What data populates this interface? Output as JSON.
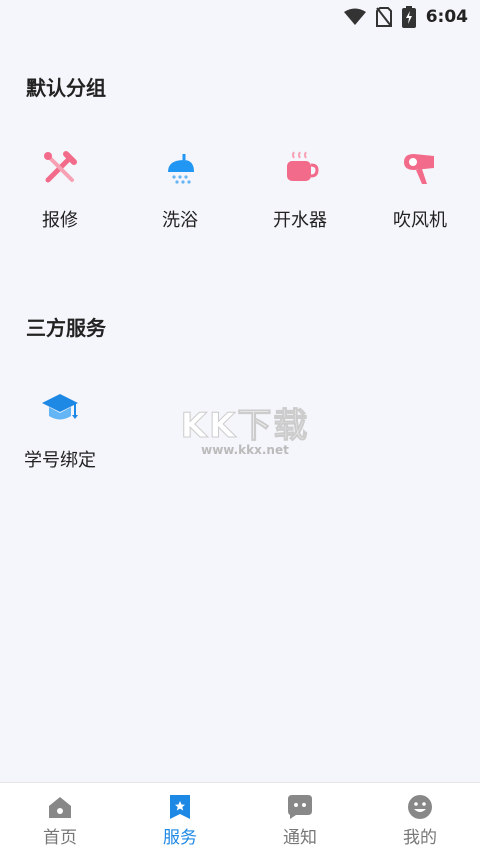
{
  "status": {
    "time": "6:04"
  },
  "groups": [
    {
      "title": "默认分组",
      "items": [
        {
          "label": "报修",
          "icon": "repair-tools-icon"
        },
        {
          "label": "洗浴",
          "icon": "shower-icon"
        },
        {
          "label": "开水器",
          "icon": "water-boiler-icon"
        },
        {
          "label": "吹风机",
          "icon": "hair-dryer-icon"
        }
      ]
    },
    {
      "title": "三方服务",
      "items": [
        {
          "label": "学号绑定",
          "icon": "graduation-cap-icon"
        }
      ]
    }
  ],
  "watermark": {
    "brand": "KK下载",
    "url": "www.kkx.net"
  },
  "nav": {
    "items": [
      {
        "label": "首页",
        "icon": "home-icon"
      },
      {
        "label": "服务",
        "icon": "service-bookmark-icon"
      },
      {
        "label": "通知",
        "icon": "chat-bubble-icon"
      },
      {
        "label": "我的",
        "icon": "smiley-user-icon"
      }
    ],
    "active_color": "#1e88e5",
    "inactive_color": "#777777"
  }
}
